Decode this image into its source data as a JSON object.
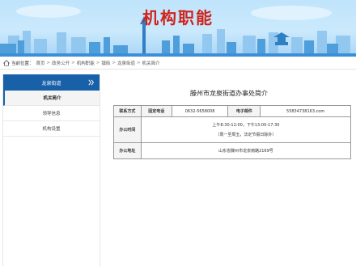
{
  "banner": {
    "title": "机构职能"
  },
  "breadcrumb": {
    "lead": "当前位置：",
    "items": [
      "首页",
      "政务公开",
      "机构职能",
      "镇街",
      "龙泉街道",
      "机关简介"
    ]
  },
  "sidebar": {
    "heading": "龙泉街道",
    "items": [
      {
        "label": "机关简介",
        "active": true
      },
      {
        "label": "领导信息",
        "active": false
      },
      {
        "label": "机构设置",
        "active": false
      }
    ]
  },
  "main": {
    "title": "滕州市龙泉街道办事处简介",
    "contact": {
      "label": "联系方式",
      "phone_label": "固定电话",
      "phone": "0632-5658008",
      "email_label": "电子邮件",
      "email": "55834738163.com"
    },
    "hours": {
      "label": "办公时间",
      "line1": "上午8:30-12:00，下午13:00-17:30",
      "line2": "（周一至周五，法定节假日除外）"
    },
    "address": {
      "label": "办公地址",
      "value": "山东省滕州市龙泉南路2169号"
    }
  },
  "colors": {
    "title_red": "#d0231b",
    "sidebar_blue": "#1860a8",
    "banner_sky": "#bfe4fb"
  }
}
